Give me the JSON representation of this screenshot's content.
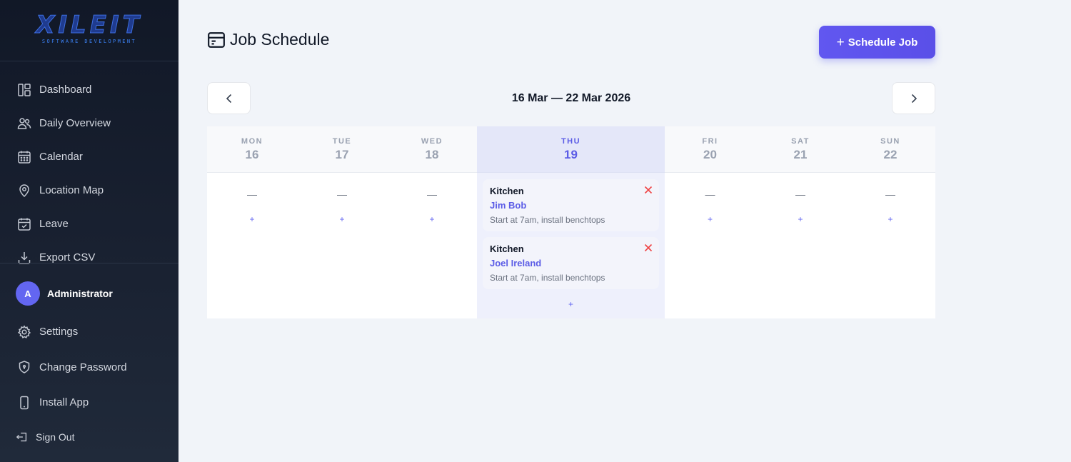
{
  "brand": {
    "name": "XILEIT",
    "tagline": "SOFTWARE DEVELOPMENT",
    "accent": "#6366f1"
  },
  "sidebar": {
    "items": [
      {
        "label": "Dashboard",
        "icon": "dashboard-icon"
      },
      {
        "label": "Daily Overview",
        "icon": "users-icon"
      },
      {
        "label": "Calendar",
        "icon": "calendar-icon"
      },
      {
        "label": "Location Map",
        "icon": "location-pin-icon"
      },
      {
        "label": "Leave",
        "icon": "calendar-check-icon"
      },
      {
        "label": "Export CSV",
        "icon": "download-icon"
      }
    ],
    "user": {
      "initial": "A",
      "name": "Administrator"
    },
    "bottom_items": [
      {
        "label": "Settings",
        "icon": "gear-icon"
      },
      {
        "label": "Change Password",
        "icon": "shield-icon"
      },
      {
        "label": "Install App",
        "icon": "phone-icon"
      }
    ],
    "signout_label": "Sign Out"
  },
  "header": {
    "title": "Job Schedule",
    "schedule_button": "Schedule Job",
    "schedule_button_plus": "+"
  },
  "week": {
    "range": "16 Mar — 22 Mar 2026",
    "empty_marker": "—",
    "add_marker": "+",
    "days": [
      {
        "dow": "MON",
        "num": "16",
        "today": false,
        "jobs": []
      },
      {
        "dow": "TUE",
        "num": "17",
        "today": false,
        "jobs": []
      },
      {
        "dow": "WED",
        "num": "18",
        "today": false,
        "jobs": []
      },
      {
        "dow": "THU",
        "num": "19",
        "today": true,
        "jobs": [
          {
            "title": "Kitchen",
            "person": "Jim Bob",
            "note": "Start at 7am, install benchtops"
          },
          {
            "title": "Kitchen",
            "person": "Joel Ireland",
            "note": "Start at 7am, install benchtops"
          }
        ]
      },
      {
        "dow": "FRI",
        "num": "20",
        "today": false,
        "jobs": []
      },
      {
        "dow": "SAT",
        "num": "21",
        "today": false,
        "jobs": []
      },
      {
        "dow": "SUN",
        "num": "22",
        "today": false,
        "jobs": []
      }
    ]
  }
}
